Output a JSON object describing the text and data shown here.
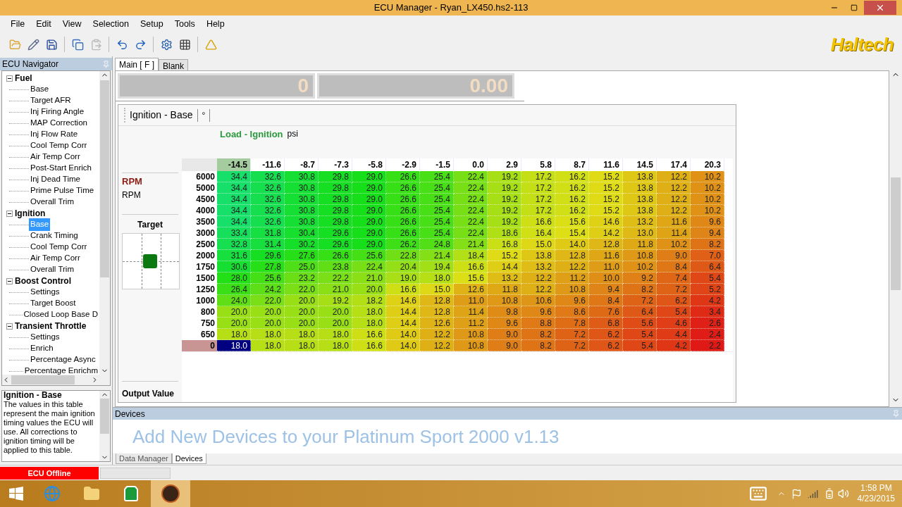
{
  "window": {
    "title": "ECU Manager - Ryan_LX450.hs2-113"
  },
  "menu": [
    "File",
    "Edit",
    "View",
    "Selection",
    "Setup",
    "Tools",
    "Help"
  ],
  "toolbar": [
    {
      "disabled": false
    },
    {
      "disabled": false
    },
    {
      "disabled": false
    },
    {
      "disabled": false
    },
    {
      "disabled": true
    },
    {
      "disabled": false
    },
    {
      "disabled": false
    },
    {
      "disabled": false
    },
    {
      "disabled": false
    },
    {
      "disabled": false
    }
  ],
  "logo": "Haltech",
  "navigator": {
    "title": "ECU Navigator",
    "items": [
      {
        "label": "Fuel",
        "expanded": true,
        "children": [
          {
            "label": "Base",
            "selected": false
          },
          {
            "label": "Target AFR",
            "selected": false
          },
          {
            "label": "Inj Firing Angle",
            "selected": false
          },
          {
            "label": "MAP Correction",
            "selected": false
          },
          {
            "label": "Inj Flow Rate",
            "selected": false
          },
          {
            "label": "Cool Temp Corr",
            "selected": false
          },
          {
            "label": "Air Temp Corr",
            "selected": false
          },
          {
            "label": "Post-Start Enrich",
            "selected": false
          },
          {
            "label": "Inj Dead Time",
            "selected": false
          },
          {
            "label": "Prime Pulse Time",
            "selected": false
          },
          {
            "label": "Overall Trim",
            "selected": false
          }
        ]
      },
      {
        "label": "Ignition",
        "expanded": true,
        "children": [
          {
            "label": "Base",
            "selected": true
          },
          {
            "label": "Crank Timing",
            "selected": false
          },
          {
            "label": "Cool Temp Corr",
            "selected": false
          },
          {
            "label": "Air Temp Corr",
            "selected": false
          },
          {
            "label": "Overall Trim",
            "selected": false
          }
        ]
      },
      {
        "label": "Boost Control",
        "expanded": true,
        "children": [
          {
            "label": "Settings",
            "selected": false
          },
          {
            "label": "Target Boost",
            "selected": false
          },
          {
            "label": "Closed Loop Base D",
            "selected": false
          }
        ]
      },
      {
        "label": "Transient Throttle",
        "expanded": true,
        "children": [
          {
            "label": "Settings",
            "selected": false
          },
          {
            "label": "Enrich",
            "selected": false
          },
          {
            "label": "Percentage Async",
            "selected": false
          },
          {
            "label": "Percentage Enrichm",
            "selected": false
          }
        ]
      }
    ]
  },
  "description": {
    "title": "Ignition - Base",
    "text": "The values in this table represent the main ignition timing values the ECU will use. All corrections to ignition timing will be applied to this table."
  },
  "tabs": [
    {
      "label": "Main [ F ]",
      "selected": true
    },
    {
      "label": "Blank",
      "selected": false
    }
  ],
  "gauges": [
    "0",
    "0.00"
  ],
  "table_panel": {
    "title": "Ignition - Base",
    "unit_tab": "°",
    "load_label": "Load - Ignition",
    "load_unit": "psi",
    "row_axis": "RPM",
    "row_unit": "RPM",
    "target_label": "Target",
    "output_label": "Output Value",
    "columns": [
      {
        "label": "-14.5",
        "selected": true
      },
      {
        "label": "-11.6",
        "selected": false
      },
      {
        "label": "-8.7",
        "selected": false
      },
      {
        "label": "-7.3",
        "selected": false
      },
      {
        "label": "-5.8",
        "selected": false
      },
      {
        "label": "-2.9",
        "selected": false
      },
      {
        "label": "-1.5",
        "selected": false
      },
      {
        "label": "0.0",
        "selected": false
      },
      {
        "label": "2.9",
        "selected": false
      },
      {
        "label": "5.8",
        "selected": false
      },
      {
        "label": "8.7",
        "selected": false
      },
      {
        "label": "11.6",
        "selected": false
      },
      {
        "label": "14.5",
        "selected": false
      },
      {
        "label": "17.4",
        "selected": false
      },
      {
        "label": "20.3",
        "selected": false
      }
    ],
    "rows": [
      {
        "label": "6000",
        "selected": false,
        "cells": [
          "34.4",
          "32.6",
          "30.8",
          "29.8",
          "29.0",
          "26.6",
          "25.4",
          "22.4",
          "19.2",
          "17.2",
          "16.2",
          "15.2",
          "13.8",
          "12.2",
          "10.2"
        ]
      },
      {
        "label": "5000",
        "selected": false,
        "cells": [
          "34.4",
          "32.6",
          "30.8",
          "29.8",
          "29.0",
          "26.6",
          "25.4",
          "22.4",
          "19.2",
          "17.2",
          "16.2",
          "15.2",
          "13.8",
          "12.2",
          "10.2"
        ]
      },
      {
        "label": "4500",
        "selected": false,
        "cells": [
          "34.4",
          "32.6",
          "30.8",
          "29.8",
          "29.0",
          "26.6",
          "25.4",
          "22.4",
          "19.2",
          "17.2",
          "16.2",
          "15.2",
          "13.8",
          "12.2",
          "10.2"
        ]
      },
      {
        "label": "4000",
        "selected": false,
        "cells": [
          "34.4",
          "32.6",
          "30.8",
          "29.8",
          "29.0",
          "26.6",
          "25.4",
          "22.4",
          "19.2",
          "17.2",
          "16.2",
          "15.2",
          "13.8",
          "12.2",
          "10.2"
        ]
      },
      {
        "label": "3500",
        "selected": false,
        "cells": [
          "34.4",
          "32.6",
          "30.8",
          "29.8",
          "29.0",
          "26.6",
          "25.4",
          "22.4",
          "19.2",
          "16.6",
          "15.6",
          "14.6",
          "13.2",
          "11.6",
          "9.6"
        ]
      },
      {
        "label": "3000",
        "selected": false,
        "cells": [
          "33.4",
          "31.8",
          "30.4",
          "29.6",
          "29.0",
          "26.6",
          "25.4",
          "22.4",
          "18.6",
          "16.4",
          "15.4",
          "14.2",
          "13.0",
          "11.4",
          "9.4"
        ]
      },
      {
        "label": "2500",
        "selected": false,
        "cells": [
          "32.8",
          "31.4",
          "30.2",
          "29.6",
          "29.0",
          "26.2",
          "24.8",
          "21.4",
          "16.8",
          "15.0",
          "14.0",
          "12.8",
          "11.8",
          "10.2",
          "8.2"
        ]
      },
      {
        "label": "2000",
        "selected": false,
        "cells": [
          "31.6",
          "29.6",
          "27.6",
          "26.6",
          "25.6",
          "22.8",
          "21.4",
          "18.4",
          "15.2",
          "13.8",
          "12.8",
          "11.6",
          "10.8",
          "9.0",
          "7.0"
        ]
      },
      {
        "label": "1750",
        "selected": false,
        "cells": [
          "30.6",
          "27.8",
          "25.0",
          "23.8",
          "22.4",
          "20.4",
          "19.4",
          "16.6",
          "14.4",
          "13.2",
          "12.2",
          "11.0",
          "10.2",
          "8.4",
          "6.4"
        ]
      },
      {
        "label": "1500",
        "selected": false,
        "cells": [
          "28.0",
          "25.6",
          "23.2",
          "22.2",
          "21.0",
          "19.0",
          "18.0",
          "15.6",
          "13.2",
          "12.2",
          "11.2",
          "10.0",
          "9.2",
          "7.4",
          "5.4"
        ]
      },
      {
        "label": "1250",
        "selected": false,
        "cells": [
          "26.4",
          "24.2",
          "22.0",
          "21.0",
          "20.0",
          "16.6",
          "15.0",
          "12.6",
          "11.8",
          "12.2",
          "10.8",
          "9.4",
          "8.2",
          "7.2",
          "5.2"
        ]
      },
      {
        "label": "1000",
        "selected": false,
        "cells": [
          "24.0",
          "22.0",
          "20.0",
          "19.2",
          "18.2",
          "14.6",
          "12.8",
          "11.0",
          "10.8",
          "10.6",
          "9.6",
          "8.4",
          "7.2",
          "6.2",
          "4.2"
        ]
      },
      {
        "label": "800",
        "selected": false,
        "cells": [
          "20.0",
          "20.0",
          "20.0",
          "20.0",
          "18.0",
          "14.4",
          "12.8",
          "11.4",
          "9.8",
          "9.6",
          "8.6",
          "7.6",
          "6.4",
          "5.4",
          "3.4"
        ]
      },
      {
        "label": "750",
        "selected": false,
        "cells": [
          "20.0",
          "20.0",
          "20.0",
          "20.0",
          "18.0",
          "14.4",
          "12.6",
          "11.2",
          "9.6",
          "8.8",
          "7.8",
          "6.8",
          "5.6",
          "4.6",
          "2.6"
        ]
      },
      {
        "label": "650",
        "selected": false,
        "cells": [
          "18.0",
          "18.0",
          "18.0",
          "18.0",
          "16.6",
          "14.0",
          "12.2",
          "10.8",
          "9.0",
          "8.2",
          "7.2",
          "6.2",
          "5.4",
          "4.4",
          "2.4"
        ]
      },
      {
        "label": "0",
        "selected": true,
        "cells": [
          "18.0",
          "18.0",
          "18.0",
          "18.0",
          "16.6",
          "14.0",
          "12.2",
          "10.8",
          "9.0",
          "8.2",
          "7.2",
          "6.2",
          "5.4",
          "4.2",
          "2.2"
        ]
      }
    ]
  },
  "devices": {
    "title": "Devices",
    "message": "Add New Devices to your Platinum Sport 2000 v1.13"
  },
  "bottom_tabs": [
    {
      "label": "Data Manager",
      "selected": false
    },
    {
      "label": "Devices",
      "selected": true
    }
  ],
  "status": {
    "ecu": "ECU Offline",
    "online": false,
    "progress": {
      "level": 0
    }
  },
  "clock": {
    "time": "1:58 PM",
    "date": "4/23/2015"
  }
}
